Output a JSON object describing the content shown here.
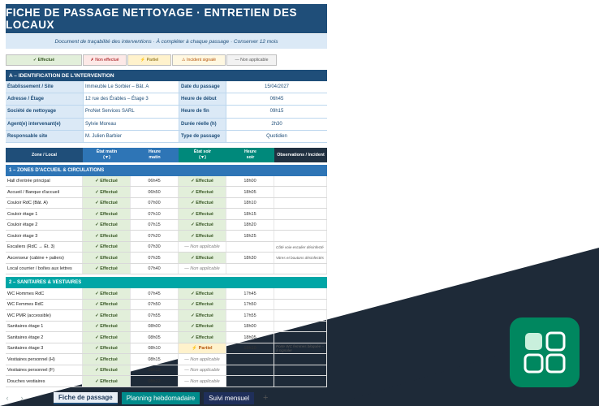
{
  "title": "FICHE DE PASSAGE NETTOYAGE  ·  ENTRETIEN DES LOCAUX",
  "subtitle": "Document de traçabilité des interventions · À compléter à chaque passage · Conserver 12 mois",
  "legend": {
    "effectue": "✓ Effectué",
    "non_effectue": "✗ Non effectué",
    "partiel": "⚡ Partiel",
    "incident": "⚠ Incident signalé",
    "non_applicable": "— Non applicable"
  },
  "section_a": {
    "title": "A  –  IDENTIFICATION DE L'INTERVENTION",
    "rows": [
      {
        "label1": "Établissement / Site",
        "value1": "Immeuble Le Sorbier – Bât. A",
        "label2": "Date du passage",
        "value2": "15/04/2027"
      },
      {
        "label1": "Adresse / Étage",
        "value1": "12 rue des Érables – Étage 3",
        "label2": "Heure de début",
        "value2": "06h45"
      },
      {
        "label1": "Société de nettoyage",
        "value1": "ProNet Services SARL",
        "label2": "Heure de fin",
        "value2": "09h15"
      },
      {
        "label1": "Agent(e) intervenant(e)",
        "value1": "Sylvie Moreau",
        "label2": "Durée réelle (h)",
        "value2": "2h30"
      },
      {
        "label1": "Responsable site",
        "value1": "M. Julien Barbier",
        "label2": "Type de passage",
        "value2": "Quotidien"
      }
    ]
  },
  "grid_headers": {
    "zone": "Zone / Local",
    "etat_matin": "État matin\n(▼)",
    "heure_matin": "Heure\nmatin",
    "etat_soir": "État soir\n(▼)",
    "heure_soir": "Heure\nsoir",
    "obs": "Observations / Incident"
  },
  "section_1": {
    "title": "1  –  ZONES D'ACCUEIL & CIRCULATIONS",
    "rows": [
      {
        "zone": "Hall d'entrée principal",
        "em": "✓ Effectué",
        "hm": "06h45",
        "es": "✓ Effectué",
        "hs": "18h00",
        "obs": ""
      },
      {
        "zone": "Accueil / Banque d'accueil",
        "em": "✓ Effectué",
        "hm": "06h50",
        "es": "✓ Effectué",
        "hs": "18h05",
        "obs": ""
      },
      {
        "zone": "Couloir RdC (Bât. A)",
        "em": "✓ Effectué",
        "hm": "07h00",
        "es": "✓ Effectué",
        "hs": "18h10",
        "obs": ""
      },
      {
        "zone": "Couloir étage 1",
        "em": "✓ Effectué",
        "hm": "07h10",
        "es": "✓ Effectué",
        "hs": "18h15",
        "obs": ""
      },
      {
        "zone": "Couloir étage 2",
        "em": "✓ Effectué",
        "hm": "07h15",
        "es": "✓ Effectué",
        "hs": "18h20",
        "obs": ""
      },
      {
        "zone": "Couloir étage 3",
        "em": "✓ Effectué",
        "hm": "07h20",
        "es": "✓ Effectué",
        "hs": "18h25",
        "obs": ""
      },
      {
        "zone": "Escaliers (RdC → Ét. 3)",
        "em": "✓ Effectué",
        "hm": "07h30",
        "es": "— Non applicable",
        "hs": "",
        "obs": "Côté voie escalier désinfecté"
      },
      {
        "zone": "Ascenseur (cabine + paliers)",
        "em": "✓ Effectué",
        "hm": "07h35",
        "es": "✓ Effectué",
        "hs": "18h30",
        "obs": "Vitres et boutons désinfectés"
      },
      {
        "zone": "Local courrier / boîtes aux lettres",
        "em": "✓ Effectué",
        "hm": "07h40",
        "es": "— Non applicable",
        "hs": "",
        "obs": ""
      }
    ]
  },
  "section_2": {
    "title": "2  –  SANITAIRES & VESTIAIRES",
    "rows": [
      {
        "zone": "WC Hommes RdC",
        "em": "✓ Effectué",
        "hm": "07h45",
        "es": "✓ Effectué",
        "hs": "17h45",
        "obs": ""
      },
      {
        "zone": "WC Femmes RdC",
        "em": "✓ Effectué",
        "hm": "07h50",
        "es": "✓ Effectué",
        "hs": "17h50",
        "obs": ""
      },
      {
        "zone": "WC PMR (accessible)",
        "em": "✓ Effectué",
        "hm": "07h55",
        "es": "✓ Effectué",
        "hs": "17h55",
        "obs": ""
      },
      {
        "zone": "Sanitaires étage 1",
        "em": "✓ Effectué",
        "hm": "08h00",
        "es": "✓ Effectué",
        "hs": "18h00",
        "obs": ""
      },
      {
        "zone": "Sanitaires étage 2",
        "em": "✓ Effectué",
        "hm": "08h05",
        "es": "✓ Effectué",
        "hs": "18h05",
        "obs": ""
      },
      {
        "zone": "Sanitaires étage 3",
        "em": "✓ Effectué",
        "hm": "08h10",
        "es": "⚡ Partiel",
        "hs": "18h10",
        "obs": "Porte WC femmes bloquée – à signaler"
      },
      {
        "zone": "Vestiaires personnel (H)",
        "em": "✓ Effectué",
        "hm": "08h15",
        "es": "— Non applicable",
        "hs": "",
        "obs": ""
      },
      {
        "zone": "Vestiaires personnel (F)",
        "em": "✓ Effectué",
        "hm": "08h18",
        "es": "— Non applicable",
        "hs": "",
        "obs": ""
      },
      {
        "zone": "Douches vestiaires",
        "em": "✓ Effectué",
        "hm": "08h22",
        "es": "— Non applicable",
        "hs": "",
        "obs": ""
      }
    ]
  },
  "tabs": {
    "tab1": "Fiche de passage",
    "tab2": "Planning hebdomadaire",
    "tab3": "Suivi mensuel",
    "add": "+"
  },
  "icons": {
    "nav_prev": "chevron-left-icon",
    "nav_next": "chevron-right-icon",
    "app": "grid-apps-icon"
  },
  "colors": {
    "navy": "#1f4e79",
    "blue": "#2e75b6",
    "teal": "#00a6a6",
    "done_bg": "#e2efda",
    "partial_bg": "#fff2cc",
    "app_icon": "#00875f"
  }
}
